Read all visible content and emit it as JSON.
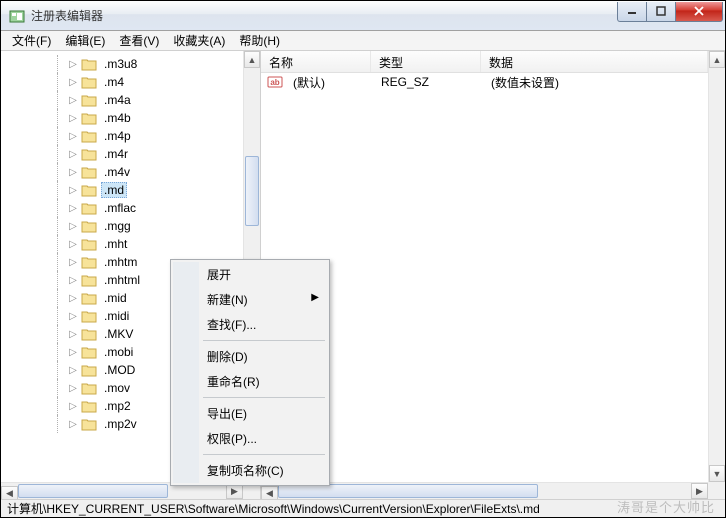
{
  "window": {
    "title": "注册表编辑器"
  },
  "menu": {
    "file": "文件(F)",
    "edit": "编辑(E)",
    "view": "查看(V)",
    "favorites": "收藏夹(A)",
    "help": "帮助(H)"
  },
  "tree": {
    "items": [
      {
        "label": ".m3u8"
      },
      {
        "label": ".m4"
      },
      {
        "label": ".m4a"
      },
      {
        "label": ".m4b"
      },
      {
        "label": ".m4p"
      },
      {
        "label": ".m4r"
      },
      {
        "label": ".m4v"
      },
      {
        "label": ".md",
        "selected": true
      },
      {
        "label": ".mflac"
      },
      {
        "label": ".mgg"
      },
      {
        "label": ".mht"
      },
      {
        "label": ".mhtm"
      },
      {
        "label": ".mhtml"
      },
      {
        "label": ".mid"
      },
      {
        "label": ".midi"
      },
      {
        "label": ".MKV"
      },
      {
        "label": ".mobi"
      },
      {
        "label": ".MOD"
      },
      {
        "label": ".mov"
      },
      {
        "label": ".mp2"
      },
      {
        "label": ".mp2v"
      }
    ]
  },
  "list": {
    "cols": {
      "name": "名称",
      "type": "类型",
      "data": "数据"
    },
    "rows": [
      {
        "name": "(默认)",
        "type": "REG_SZ",
        "data": "(数值未设置)"
      }
    ]
  },
  "context": {
    "expand": "展开",
    "new": "新建(N)",
    "find": "查找(F)...",
    "delete": "删除(D)",
    "rename": "重命名(R)",
    "export": "导出(E)",
    "permissions": "权限(P)...",
    "copyKeyName": "复制项名称(C)"
  },
  "status": {
    "path": "计算机\\HKEY_CURRENT_USER\\Software\\Microsoft\\Windows\\CurrentVersion\\Explorer\\FileExts\\.md"
  },
  "watermark": "涛哥是个大帅比"
}
